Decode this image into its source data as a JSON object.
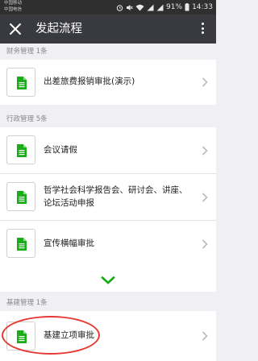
{
  "status_bar": {
    "carrier_1": "中国移动",
    "carrier_2": "中国电信",
    "battery": "91%",
    "time": "14:33"
  },
  "header": {
    "title": "发起流程",
    "close_icon": "close-icon",
    "more_icon": "more-vertical-icon"
  },
  "sections": [
    {
      "header": "财务管理 1条",
      "items": [
        {
          "label": "出差旅费报销审批(演示)"
        }
      ]
    },
    {
      "header": "行政管理 5条",
      "items": [
        {
          "label_line1": "会议请假"
        },
        {
          "label_line1": "哲学社会科学报告会、研讨会、讲座、",
          "label_line2": "论坛活动申报"
        },
        {
          "label_line1": "宣传横幅审批"
        }
      ]
    },
    {
      "header": "基建管理 1条",
      "items": [
        {
          "label": "基建立项审批"
        }
      ]
    }
  ],
  "colors": {
    "accent": "#1aad19",
    "titlebar": "#393a3f",
    "highlight": "#e53935"
  }
}
